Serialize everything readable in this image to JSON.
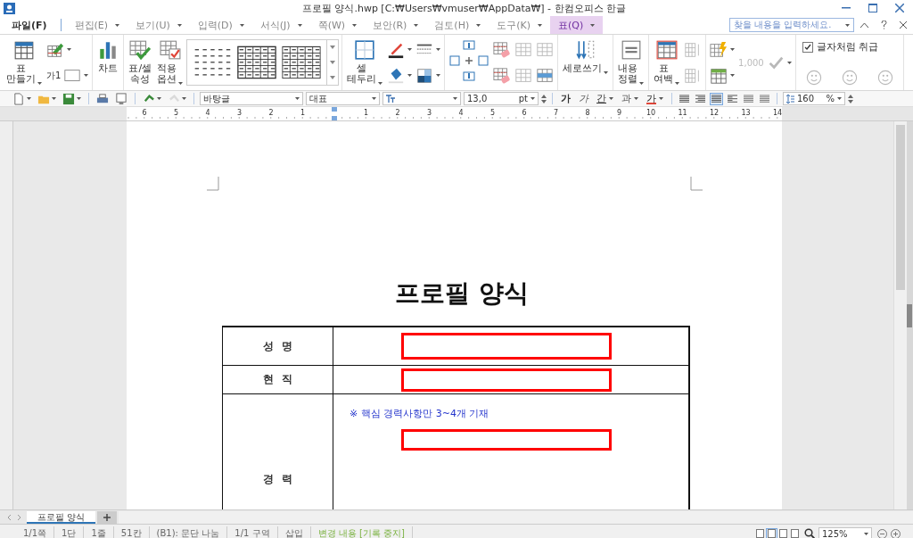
{
  "window": {
    "title": "프로필 양식.hwp [C:₩Users₩vmuser₩AppData₩] - 한컴오피스 한글"
  },
  "menu": [
    {
      "label": "파일(F)",
      "kind": "file",
      "selected": false
    },
    {
      "label": "편집(E)",
      "kind": "menu",
      "selected": false
    },
    {
      "label": "보기(U)",
      "kind": "menu",
      "selected": false
    },
    {
      "label": "입력(D)",
      "kind": "menu",
      "selected": false
    },
    {
      "label": "서식(J)",
      "kind": "menu",
      "selected": false
    },
    {
      "label": "쪽(W)",
      "kind": "menu",
      "selected": false
    },
    {
      "label": "보안(R)",
      "kind": "menu",
      "selected": false
    },
    {
      "label": "검토(H)",
      "kind": "menu",
      "selected": false
    },
    {
      "label": "도구(K)",
      "kind": "menu",
      "selected": false
    },
    {
      "label": "표(Q)",
      "kind": "menu",
      "selected": true
    }
  ],
  "search": {
    "placeholder": "찾을 내용을 입력하세요."
  },
  "ribbon": [
    [
      {
        "kind": "large",
        "label": "표 만들기",
        "menu": true,
        "disabled": false
      },
      {
        "kind": "small",
        "buttons": [
          {
            "menu": true,
            "disabled": false
          },
          {
            "label": "가1",
            "menu": true,
            "disabled": false
          }
        ]
      }
    ],
    [
      {
        "kind": "large",
        "label": "차트",
        "menu": false,
        "disabled": false
      }
    ],
    [
      {
        "kind": "large",
        "label": "표/셀 속성",
        "menu": false,
        "disabled": false
      },
      {
        "kind": "large",
        "label": "적용 옵션",
        "menu": true,
        "disabled": false
      },
      {
        "kind": "gallery"
      }
    ],
    [
      {
        "kind": "large",
        "label": "셀 테두리",
        "menu": true,
        "disabled": false
      },
      {
        "kind": "small",
        "buttons": [
          {
            "menu": true,
            "disabled": false
          },
          {
            "menu": true,
            "disabled": false
          }
        ]
      },
      {
        "kind": "small",
        "buttons": [
          {
            "menu": true,
            "disabled": false
          },
          {
            "menu": true,
            "disabled": false
          }
        ]
      }
    ],
    [
      {
        "kind": "icon",
        "disabled": false
      },
      {
        "kind": "small",
        "buttons": [
          {
            "menu": false,
            "disabled": false
          },
          {
            "menu": false,
            "disabled": false
          }
        ]
      },
      {
        "kind": "small",
        "buttons": [
          {
            "menu": false,
            "disabled": true
          },
          {
            "menu": false,
            "disabled": true
          }
        ]
      },
      {
        "kind": "small",
        "buttons": [
          {
            "menu": false,
            "disabled": true
          },
          {
            "menu": false,
            "disabled": false
          }
        ]
      }
    ],
    [
      {
        "kind": "large",
        "label": "세로쓰기",
        "menu": true,
        "disabled": false
      }
    ],
    [
      {
        "kind": "large",
        "label": "내용 정렬",
        "menu": true,
        "disabled": false
      }
    ],
    [
      {
        "kind": "large",
        "label": "표 여백",
        "menu": true,
        "disabled": false
      },
      {
        "kind": "small",
        "buttons": [
          {
            "menu": false,
            "disabled": true
          },
          {
            "menu": false,
            "disabled": true
          }
        ]
      }
    ],
    [
      {
        "kind": "small",
        "buttons": [
          {
            "menu": true,
            "disabled": false
          },
          {
            "menu": true,
            "disabled": false
          }
        ]
      },
      {
        "kind": "small",
        "buttons": [
          {
            "label": "1,000",
            "menu": true,
            "disabled": true
          }
        ]
      }
    ],
    [
      {
        "kind": "check",
        "label": "글자처럼 취급",
        "checked": true,
        "buttons": [
          {
            "disabled": true
          },
          {
            "disabled": true
          },
          {
            "disabled": true
          }
        ]
      }
    ]
  ],
  "quick_buttons": [
    {
      "menu": true,
      "disabled": false
    },
    {
      "menu": true,
      "disabled": false
    },
    {
      "menu": true,
      "disabled": false
    },
    {
      "menu": false,
      "disabled": false
    },
    {
      "menu": false,
      "disabled": false
    },
    {
      "menu": true,
      "disabled": false
    },
    {
      "menu": true,
      "disabled": true
    }
  ],
  "style_field": {
    "value": "바탕글"
  },
  "language_field": {
    "value": "대표"
  },
  "size_field": {
    "value": "13,0",
    "unit": "pt"
  },
  "char_buttons": [
    {
      "label": "가",
      "kind": "bold",
      "menu": false
    },
    {
      "label": "가",
      "kind": "italic",
      "menu": false
    },
    {
      "label": "간",
      "kind": "underline",
      "menu": true
    },
    {
      "label": "과",
      "kind": "strike",
      "menu": true
    },
    {
      "label": "가",
      "kind": "color",
      "menu": true
    }
  ],
  "align_buttons": [
    {
      "selected": false
    },
    {
      "selected": false
    },
    {
      "selected": true
    },
    {
      "selected": false
    },
    {
      "selected": false
    },
    {
      "selected": false
    }
  ],
  "line_spacing": {
    "value": "160",
    "unit": "%"
  },
  "ruler": {
    "labels": [
      "6",
      "5",
      "4",
      "3",
      "2",
      "1",
      "1",
      "2",
      "3",
      "4",
      "5",
      "6",
      "7",
      "8",
      "9",
      "10",
      "11",
      "12",
      "13",
      "14"
    ]
  },
  "document": {
    "title": "프로필 양식",
    "rows": [
      {
        "label": "성  명"
      },
      {
        "label": "현  직"
      },
      {
        "label": "경  력",
        "note": "※ 핵심 경력사항만 3~4개 기재"
      }
    ]
  },
  "sheet_tabs": [
    {
      "label": "프로필 양식",
      "selected": true
    }
  ],
  "status_bar": [
    {
      "text": "1/1쪽",
      "kind": "plain"
    },
    {
      "text": "1단",
      "kind": "plain"
    },
    {
      "text": "1줄",
      "kind": "plain"
    },
    {
      "text": "51칸",
      "kind": "plain"
    },
    {
      "text": "(B1): 문단 나눔",
      "kind": "plain"
    },
    {
      "text": "1/1 구역",
      "kind": "plain"
    },
    {
      "text": "삽입",
      "kind": "plain"
    },
    {
      "text": "변경 내용 [기록 중지]",
      "kind": "tracking"
    }
  ],
  "view_buttons": [
    {
      "selected": false
    },
    {
      "selected": true
    },
    {
      "selected": false
    },
    {
      "selected": false
    }
  ],
  "zoom": {
    "value": "125%"
  }
}
